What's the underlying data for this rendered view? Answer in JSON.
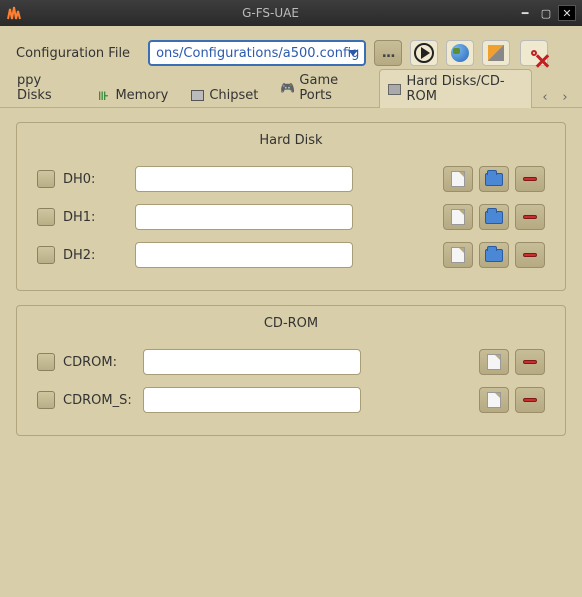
{
  "window": {
    "title": "G-FS-UAE"
  },
  "config": {
    "label": "Configuration File",
    "value": "ons/Configurations/a500.config"
  },
  "tabs": {
    "floppy": "ppy Disks",
    "memory": "Memory",
    "chipset": "Chipset",
    "game_ports": "Game Ports",
    "hard_disks": "Hard Disks/CD-ROM"
  },
  "sections": {
    "hard_disk": {
      "title": "Hard Disk",
      "rows": [
        {
          "label": "DH0:",
          "value": ""
        },
        {
          "label": "DH1:",
          "value": ""
        },
        {
          "label": "DH2:",
          "value": ""
        }
      ]
    },
    "cdrom": {
      "title": "CD-ROM",
      "rows": [
        {
          "label": "CDROM:",
          "value": ""
        },
        {
          "label": "CDROM_S:",
          "value": ""
        }
      ]
    }
  }
}
